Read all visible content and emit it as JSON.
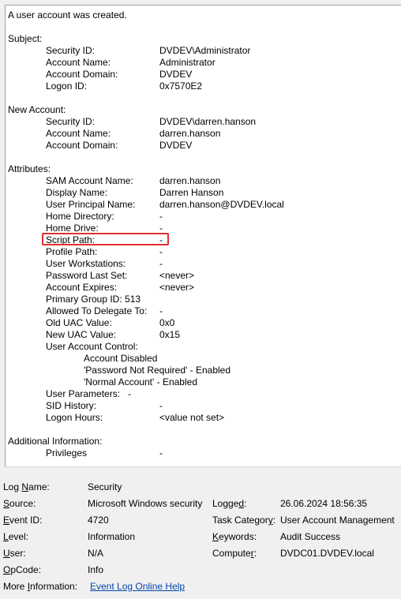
{
  "description": {
    "headline": "A user account was created.",
    "subject": {
      "header": "Subject:",
      "fields": [
        {
          "label": "Security ID:",
          "value": "DVDEV\\Administrator"
        },
        {
          "label": "Account Name:",
          "value": "Administrator"
        },
        {
          "label": "Account Domain:",
          "value": "DVDEV"
        },
        {
          "label": "Logon ID:",
          "value": "0x7570E2"
        }
      ]
    },
    "new_account": {
      "header": "New Account:",
      "fields": [
        {
          "label": "Security ID:",
          "value": "DVDEV\\darren.hanson"
        },
        {
          "label": "Account Name:",
          "value": "darren.hanson"
        },
        {
          "label": "Account Domain:",
          "value": "DVDEV"
        }
      ]
    },
    "attributes": {
      "header": "Attributes:",
      "fields": [
        {
          "label": "SAM Account Name:",
          "value": "darren.hanson"
        },
        {
          "label": "Display Name:",
          "value": "Darren Hanson"
        },
        {
          "label": "User Principal Name:",
          "value": "darren.hanson@DVDEV.local"
        },
        {
          "label": "Home Directory:",
          "value": "-"
        },
        {
          "label": "Home Drive:",
          "value": "-"
        },
        {
          "label": "Script Path:",
          "value": "-"
        },
        {
          "label": "Profile Path:",
          "value": "-"
        },
        {
          "label": "User Workstations:",
          "value": "-"
        },
        {
          "label": "Password Last Set:",
          "value": "<never>"
        },
        {
          "label": "Account Expires:",
          "value": "<never>"
        },
        {
          "label": "Primary Group ID: 513",
          "value": ""
        },
        {
          "label": "Allowed To Delegate To:",
          "value": "-"
        },
        {
          "label": "Old UAC Value:",
          "value": "0x0"
        },
        {
          "label": "New UAC Value:",
          "value": "0x15"
        },
        {
          "label": "User Account Control:",
          "value": ""
        }
      ],
      "uac_flags": [
        "Account Disabled",
        "'Password Not Required' - Enabled",
        "'Normal Account' - Enabled"
      ],
      "user_parameters": "User Parameters:   -",
      "tail_fields": [
        {
          "label": "SID History:",
          "value": "-"
        },
        {
          "label": "Logon Hours:",
          "value": "<value not set>"
        }
      ]
    },
    "additional": {
      "header": "Additional Information:",
      "fields": [
        {
          "label": "Privileges",
          "value": "-"
        }
      ]
    }
  },
  "details": {
    "log_name": {
      "label": "Log Name:",
      "value": "Security"
    },
    "source": {
      "label": "Source:",
      "value": "Microsoft Windows security"
    },
    "logged": {
      "label": "Logged:",
      "value": "26.06.2024 18:56:35"
    },
    "event_id": {
      "label": "Event ID:",
      "value": "4720"
    },
    "task_category": {
      "label": "Task Category:",
      "value": "User Account Management"
    },
    "level": {
      "label": "Level:",
      "value": "Information"
    },
    "keywords": {
      "label": "Keywords:",
      "value": "Audit Success"
    },
    "user": {
      "label": "User:",
      "value": "N/A"
    },
    "computer": {
      "label": "Computer:",
      "value": "DVDC01.DVDEV.local"
    },
    "opcode": {
      "label": "OpCode:",
      "value": "Info"
    },
    "more_info": {
      "label": "More Information:",
      "link": "Event Log Online Help"
    }
  },
  "colors": {
    "highlight_border": "#e03030",
    "link": "#0645ad"
  }
}
